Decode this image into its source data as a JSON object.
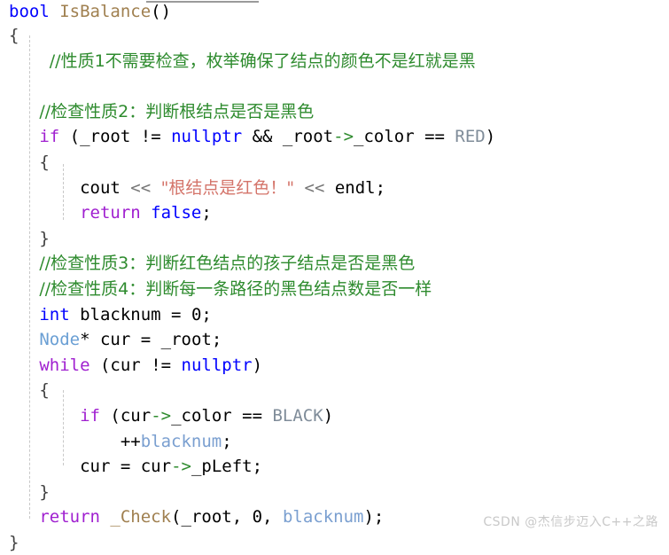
{
  "editor": {
    "language": "C++",
    "background_color": "#ffffff",
    "font_size_px": 19,
    "line_height_px": 28.6,
    "indent_guides": 3,
    "colors": {
      "keyword": "#0000ff",
      "control": "#a020d0",
      "function": "#a08050",
      "type": "#6a9fd4",
      "comment": "#2e8b2e",
      "string": "#d4746a",
      "constant": "#7f8c99",
      "variable": "#7a9fd0",
      "arrow_operator": "#2e8b2e",
      "plain": "#000000",
      "indent_guide": "#c8c8c8",
      "watermark": "#c9c9c9"
    }
  },
  "code": {
    "line_01": {
      "kw": "bool",
      "fn": "IsBalance",
      "punct": "()"
    },
    "line_02": {
      "brace": "{"
    },
    "line_03": {
      "comment": "//性质1不需要检查，枚举确保了结点的颜色不是红就是黑"
    },
    "line_04": {
      "blank": ""
    },
    "line_05": {
      "comment": "//检查性质2：判断根结点是否是黑色"
    },
    "line_06": {
      "ctrl": "if",
      "open": " (",
      "var1": "_root",
      "op1": " != ",
      "kw": "nullptr",
      "op2": " && ",
      "var2": "_root",
      "arrow": "->",
      "member": "_color",
      "op3": " == ",
      "const": "RED",
      "close": ")"
    },
    "line_07": {
      "brace": "{"
    },
    "line_08": {
      "id": "cout",
      "shift1": " << ",
      "string": "\"根结点是红色！\"",
      "shift2": " << ",
      "id2": "endl",
      "semi": ";"
    },
    "line_09": {
      "ctrl": "return",
      "kw": " false",
      "semi": ";"
    },
    "line_10": {
      "brace": "}"
    },
    "line_11": {
      "comment": "//检查性质3：判断红色结点的孩子结点是否是黑色"
    },
    "line_12": {
      "comment": "//检查性质4：判断每一条路径的黑色结点数是否一样"
    },
    "line_13": {
      "kw": "int",
      "id": " blacknum",
      "op": " = ",
      "num": "0",
      "semi": ";"
    },
    "line_14": {
      "type": "Node",
      "star": "* ",
      "id": "cur",
      "op": " = ",
      "id2": "_root",
      "semi": ";"
    },
    "line_15": {
      "ctrl": "while",
      "open": " (",
      "id": "cur",
      "op": " != ",
      "kw": "nullptr",
      "close": ")"
    },
    "line_16": {
      "brace": "{"
    },
    "line_17": {
      "ctrl": "if",
      "open": " (",
      "id": "cur",
      "arrow": "->",
      "member": "_color",
      "op": " == ",
      "const": "BLACK",
      "close": ")"
    },
    "line_18": {
      "inc": "++",
      "id": "blacknum",
      "semi": ";"
    },
    "line_19": {
      "id": "cur",
      "op": " = ",
      "id2": "cur",
      "arrow": "->",
      "member": "_pLeft",
      "semi": ";"
    },
    "line_20": {
      "brace": "}"
    },
    "line_21": {
      "ctrl": "return",
      "fn": " _Check",
      "open": "(",
      "arg1": "_root",
      "c1": ", ",
      "arg2": "0",
      "c2": ", ",
      "arg3": "blacknum",
      "close": ")",
      "semi": ";"
    },
    "line_22": {
      "brace": "}"
    }
  },
  "watermark": {
    "text": "CSDN @杰信步迈入C++之路"
  }
}
